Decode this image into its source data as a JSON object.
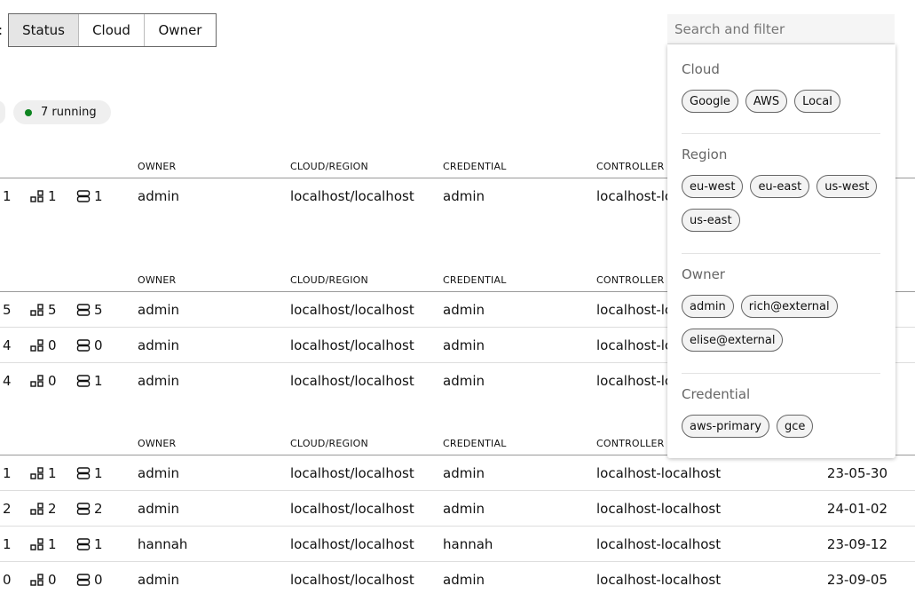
{
  "group_by": {
    "label": ":",
    "options": [
      "Status",
      "Cloud",
      "Owner"
    ],
    "active": "Status"
  },
  "status_chip": {
    "label": "7 running",
    "dot_color": "#0e8420"
  },
  "columns": {
    "owner": "OWNER",
    "cloud_region": "CLOUD/REGION",
    "credential": "CREDENTIAL",
    "controller": "CONTROLLER"
  },
  "groups": [
    {
      "rows": [
        {
          "count": "1",
          "units": "1",
          "machines": "1",
          "owner": "admin",
          "cloud_region": "localhost/localhost",
          "credential": "admin",
          "controller": "localhost-lc",
          "updated": ""
        }
      ]
    },
    {
      "rows": [
        {
          "count": "5",
          "units": "5",
          "machines": "5",
          "owner": "admin",
          "cloud_region": "localhost/localhost",
          "credential": "admin",
          "controller": "localhost-lc",
          "updated": ""
        },
        {
          "count": "4",
          "units": "0",
          "machines": "0",
          "owner": "admin",
          "cloud_region": "localhost/localhost",
          "credential": "admin",
          "controller": "localhost-lc",
          "updated": ""
        },
        {
          "count": "4",
          "units": "0",
          "machines": "1",
          "owner": "admin",
          "cloud_region": "localhost/localhost",
          "credential": "admin",
          "controller": "localhost-lc",
          "updated": ""
        }
      ]
    },
    {
      "rows": [
        {
          "count": "1",
          "units": "1",
          "machines": "1",
          "owner": "admin",
          "cloud_region": "localhost/localhost",
          "credential": "admin",
          "controller": "localhost-localhost",
          "updated": "23-05-30"
        },
        {
          "count": "2",
          "units": "2",
          "machines": "2",
          "owner": "admin",
          "cloud_region": "localhost/localhost",
          "credential": "admin",
          "controller": "localhost-localhost",
          "updated": "24-01-02"
        },
        {
          "count": "1",
          "units": "1",
          "machines": "1",
          "owner": "hannah",
          "cloud_region": "localhost/localhost",
          "credential": "hannah",
          "controller": "localhost-localhost",
          "updated": "23-09-12"
        },
        {
          "count": "0",
          "units": "0",
          "machines": "0",
          "owner": "admin",
          "cloud_region": "localhost/localhost",
          "credential": "admin",
          "controller": "localhost-localhost",
          "updated": "23-09-05"
        }
      ]
    }
  ],
  "search": {
    "placeholder": "Search and filter"
  },
  "filter_panel": {
    "sections": [
      {
        "title": "Cloud",
        "items": [
          "Google",
          "AWS",
          "Local"
        ]
      },
      {
        "title": "Region",
        "items": [
          "eu-west",
          "eu-east",
          "us-west",
          "us-east"
        ]
      },
      {
        "title": "Owner",
        "items": [
          "admin",
          "rich@external",
          "elise@external"
        ]
      },
      {
        "title": "Credential",
        "items": [
          "aws-primary",
          "gce"
        ]
      }
    ]
  },
  "icons": {
    "units": "units-icon",
    "machines": "machines-icon"
  }
}
